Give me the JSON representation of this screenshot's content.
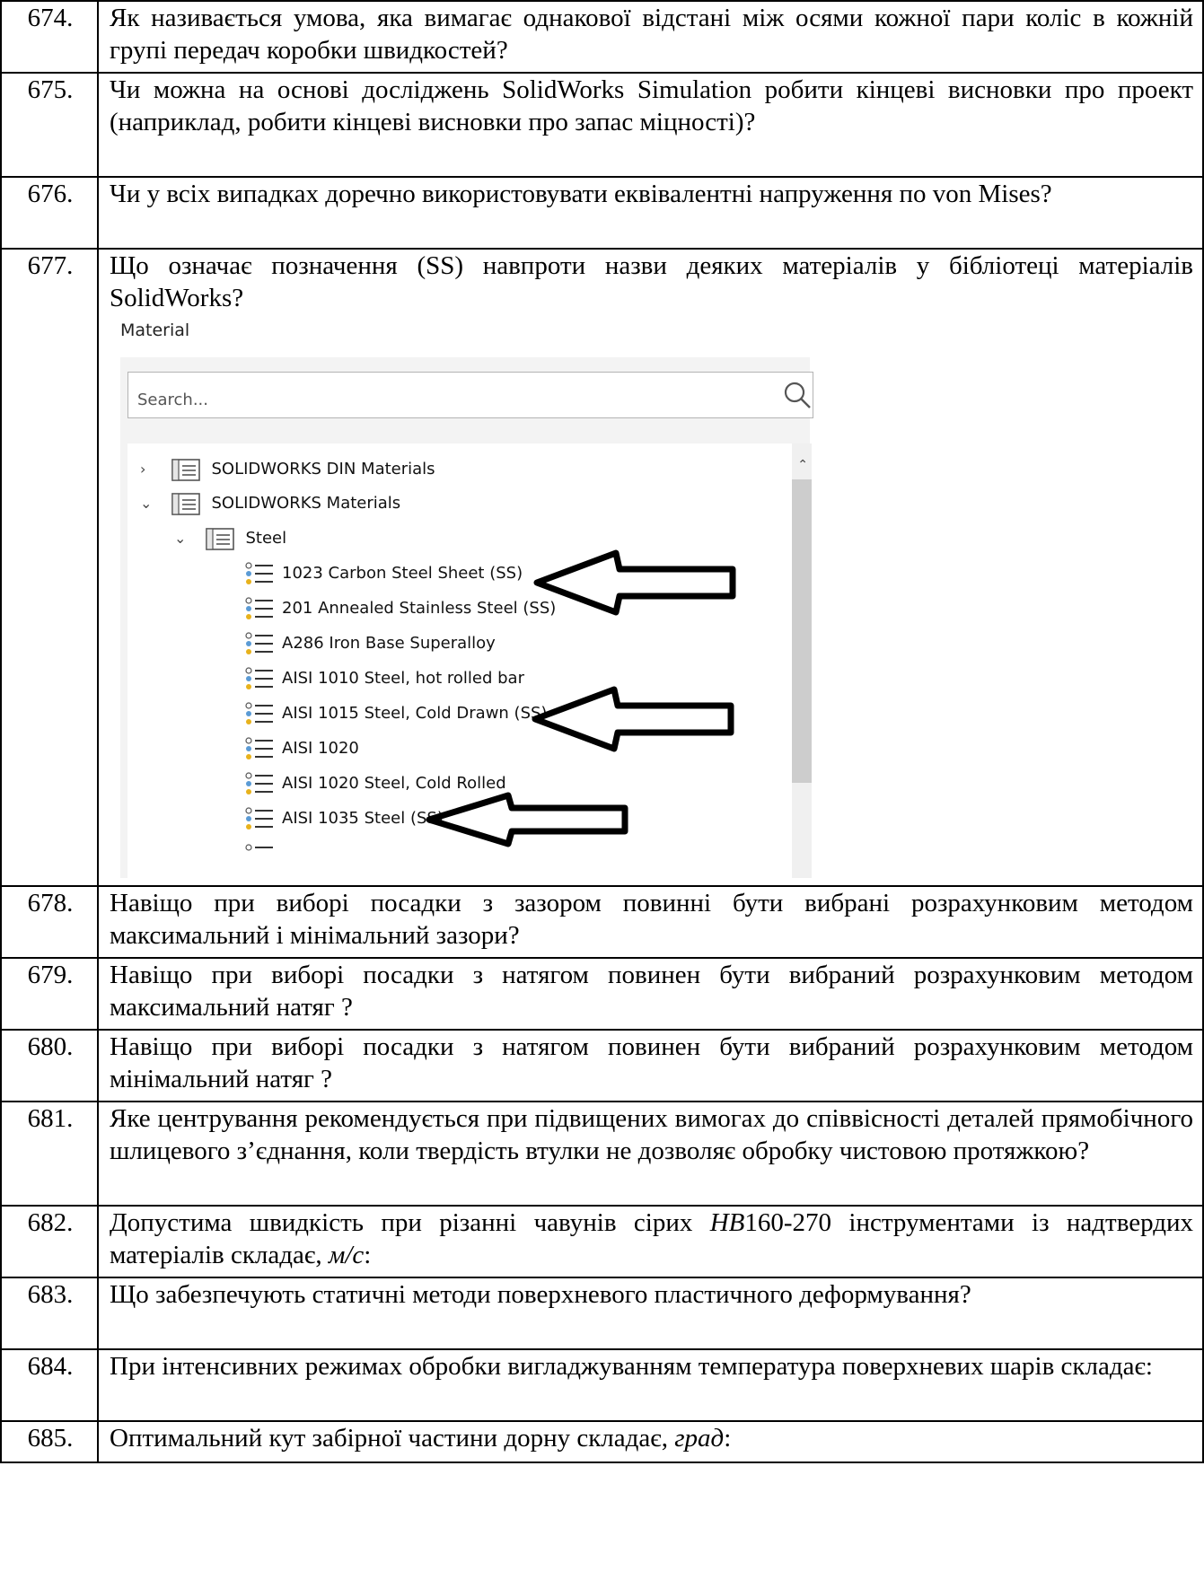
{
  "rows": [
    {
      "num": "674.",
      "text": "Як називається умова, яка вимагає однакової відстані між осями кожної пари коліс в кожній групі передач коробки швидкостей?"
    },
    {
      "num": "675.",
      "text": "Чи можна на основі досліджень SolidWorks Simulation робити кінцеві висновки про проект (наприклад, робити кінцеві висновки про запас міцності)?"
    },
    {
      "num": "676.",
      "text": "Чи у всіх випадках доречно використовувати еквівалентні напруження по von Mises?"
    },
    {
      "num": "677.",
      "text": "Що означає позначення (SS) навпроти назви деяких матеріалів у бібліотеці матеріалів SolidWorks?"
    },
    {
      "num": "678.",
      "text": "Навіщо при виборі посадки з зазором повинні бути вибрані розрахунковим методом максимальний і мінімальний зазори?"
    },
    {
      "num": "679.",
      "text": "Навіщо при виборі посадки з натягом повинен бути вибраний розрахунковим методом максимальний натяг ?"
    },
    {
      "num": "680.",
      "text": "Навіщо при виборі посадки з натягом повинен бути вибраний розрахунковим методом мінімальний натяг ?"
    },
    {
      "num": "681.",
      "text": "Яке центрування рекомендується при підвищених вимогах до співвісності деталей прямобічного шлицевого з’єднання, коли твердість втулки не дозволяє обробку чистовою протяжкою?"
    },
    {
      "num": "682.",
      "text_a": "Допустима швидкість при різанні чавунів сірих ",
      "text_hb": "НВ",
      "text_b": "160-270 інструментами із надтвердих матеріалів складає, ",
      "text_unit": "м/с",
      "text_c": ":"
    },
    {
      "num": "683.",
      "text": "Що забезпечують статичні методи поверхневого пластичного деформування?"
    },
    {
      "num": "684.",
      "text": "При інтенсивних режимах обробки вигладжуванням температура поверхневих шарів складає:"
    },
    {
      "num": "685.",
      "text_a": "Оптимальний кут забірної частини дорну складає, ",
      "text_unit": "град",
      "text_c": ":"
    }
  ],
  "screenshot": {
    "label": "Material",
    "search_placeholder": "Search...",
    "tree": [
      {
        "label": "SOLIDWORKS DIN Materials",
        "chevron": ">"
      },
      {
        "label": "SOLIDWORKS Materials",
        "chevron": "v"
      },
      {
        "label": "Steel",
        "chevron": "v"
      },
      {
        "label": "1023 Carbon Steel Sheet (SS)"
      },
      {
        "label": "201 Annealed Stainless Steel (SS)"
      },
      {
        "label": "A286 Iron Base Superalloy"
      },
      {
        "label": "AISI 1010 Steel, hot rolled bar"
      },
      {
        "label": "AISI 1015 Steel, Cold Drawn (SS)"
      },
      {
        "label": "AISI 1020"
      },
      {
        "label": "AISI 1020 Steel, Cold Rolled"
      },
      {
        "label": "AISI 1035 Steel (SS)"
      }
    ]
  }
}
